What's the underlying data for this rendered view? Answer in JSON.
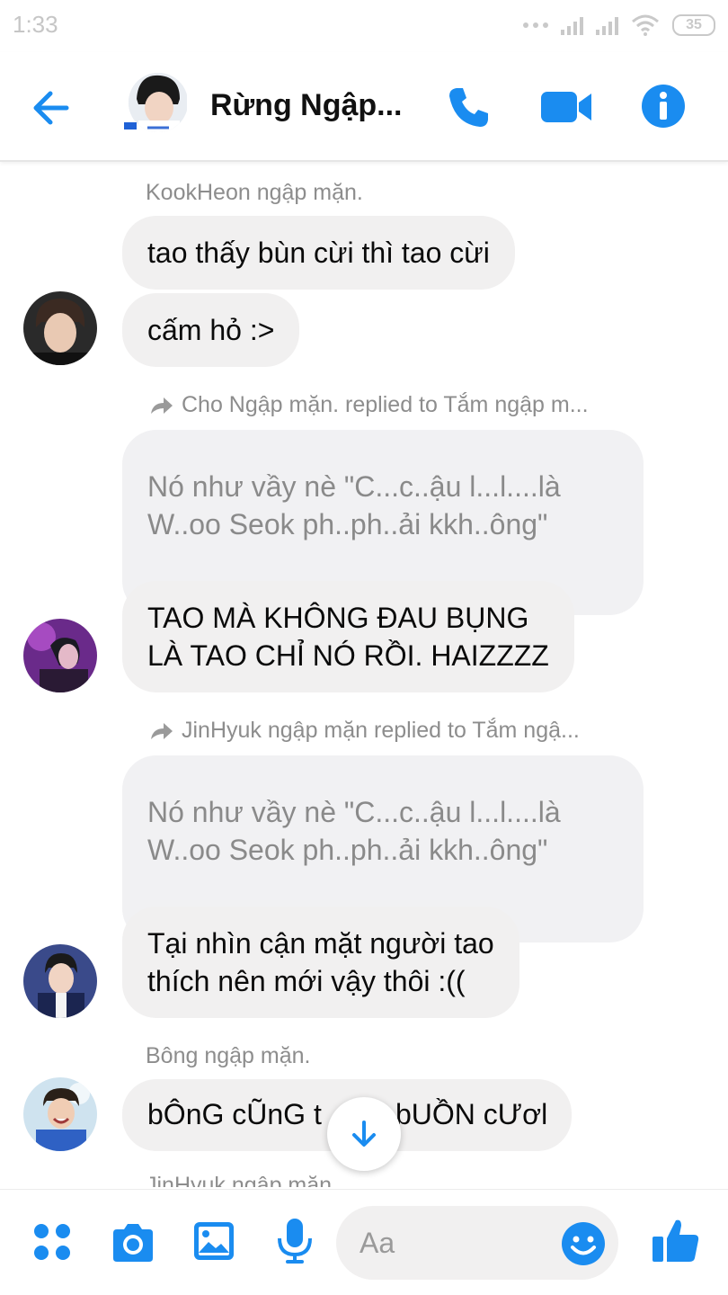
{
  "status_bar": {
    "time": "1:33",
    "battery": "35"
  },
  "header": {
    "title": "Rừng Ngập...",
    "accent_color": "#1a8cf0"
  },
  "messages": [
    {
      "sender": "KookHeon ngập mặn.",
      "bubbles": [
        "tao thấy bùn cừi thì tao cừi",
        "cấm hỏ :>"
      ]
    },
    {
      "reply_note": "Cho Ngập mặn. replied to Tắm ngập m...",
      "quoted": [
        "Nó như vầy nè \"C...c..ậu l...l....là",
        "W..oo Seok ph..ph..ải kkh..ông\""
      ],
      "bubble": [
        "TAO MÀ KHÔNG ĐAU BỤNG",
        "LÀ TAO CHỈ NÓ RỒI. HAIZZZZ"
      ]
    },
    {
      "reply_note": "JinHyuk ngập mặn replied to Tắm ngậ...",
      "quoted": [
        "Nó như vầy nè \"C...c..ậu l...l....là",
        "W..oo Seok ph..ph..ải kkh..ông\""
      ],
      "bubble": [
        "Tại nhìn cận mặt người tao",
        "thích nên mới vậy thôi :(("
      ]
    },
    {
      "sender": "Bông ngập mặn.",
      "bubbles": [
        "bÔnG cŨnG t",
        "bUỒN cƯơl"
      ]
    },
    {
      "sender": "JinHyuk ngập mặn"
    }
  ],
  "composer": {
    "placeholder": "Aa"
  },
  "icons": {
    "back": "back-arrow-icon",
    "call": "phone-icon",
    "video": "video-camera-icon",
    "info": "info-icon",
    "more": "four-dots-icon",
    "camera": "camera-icon",
    "gallery": "image-icon",
    "voice": "microphone-icon",
    "emoji": "smiley-icon",
    "like": "thumbs-up-icon",
    "scroll": "arrow-down-icon"
  }
}
